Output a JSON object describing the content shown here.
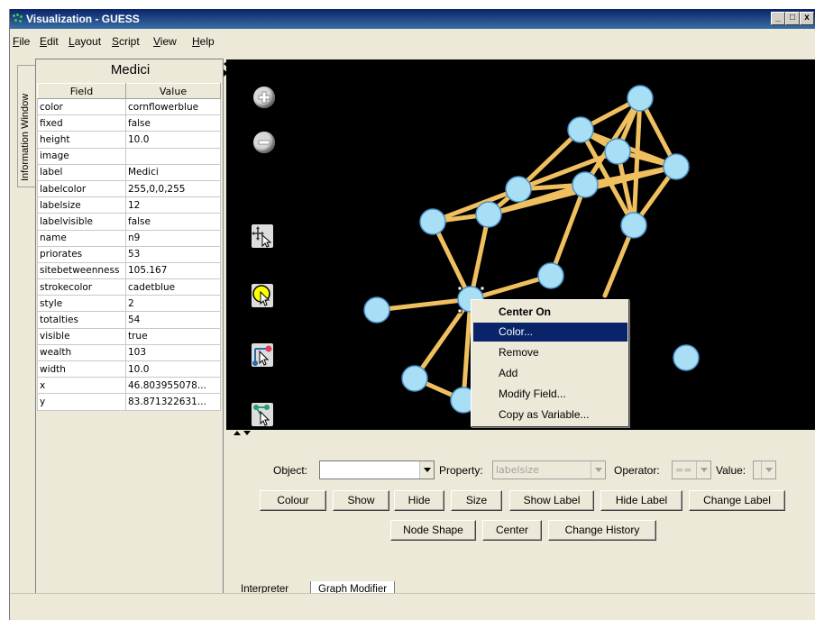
{
  "window": {
    "title": "Visualization - GUESS",
    "buttons": [
      "_",
      "□",
      "x"
    ]
  },
  "menu": [
    {
      "label": "File",
      "underline": "F",
      "rest": "ile"
    },
    {
      "label": "Edit",
      "underline": "E",
      "rest": "dit"
    },
    {
      "label": "Layout",
      "underline": "L",
      "rest": "ayout"
    },
    {
      "label": "Script",
      "underline": "S",
      "rest": "cript"
    },
    {
      "label": "View",
      "underline": "V",
      "rest": "iew"
    },
    {
      "label": "Help",
      "underline": "H",
      "rest": "elp"
    }
  ],
  "side_tab": "Information Window",
  "info": {
    "title": "Medici",
    "columns": [
      "Field",
      "Value"
    ],
    "rows": [
      [
        "color",
        "cornflowerblue"
      ],
      [
        "fixed",
        "false"
      ],
      [
        "height",
        "10.0"
      ],
      [
        "image",
        ""
      ],
      [
        "label",
        "Medici"
      ],
      [
        "labelcolor",
        "255,0,0,255"
      ],
      [
        "labelsize",
        "12"
      ],
      [
        "labelvisible",
        "false"
      ],
      [
        "name",
        "n9"
      ],
      [
        "priorates",
        "53"
      ],
      [
        "sitebetweenness",
        "105.167"
      ],
      [
        "strokecolor",
        "cadetblue"
      ],
      [
        "style",
        "2"
      ],
      [
        "totalties",
        "54"
      ],
      [
        "visible",
        "true"
      ],
      [
        "wealth",
        "103"
      ],
      [
        "width",
        "10.0"
      ],
      [
        "x",
        "46.803955078..."
      ],
      [
        "y",
        "83.871322631..."
      ]
    ]
  },
  "colors": {
    "node_fill": "#a8dff5",
    "node_stroke": "#4a90c8",
    "edge": "#f0c060",
    "canvas": "#000000",
    "menu_highlight": "#0a246a"
  },
  "graph_icons": [
    "zoom-in-icon",
    "zoom-out-icon",
    "move-tool-icon",
    "select-tool-icon",
    "edge-tool-icon",
    "node-drag-tool-icon"
  ],
  "context_menu": {
    "items": [
      {
        "label": "Center On",
        "bold": true,
        "selected": false
      },
      {
        "label": "Color...",
        "bold": false,
        "selected": true
      },
      {
        "label": "Remove",
        "bold": false,
        "selected": false
      },
      {
        "label": "Add",
        "bold": false,
        "selected": false
      },
      {
        "label": "Modify Field...",
        "bold": false,
        "selected": false
      },
      {
        "label": "Copy as Variable...",
        "bold": false,
        "selected": false
      }
    ]
  },
  "modifier": {
    "object_label": "Object:",
    "object_value": "",
    "property_label": "Property:",
    "property_value": "labelsize",
    "operator_label": "Operator:",
    "operator_value": "==",
    "value_label": "Value:",
    "value_value": "",
    "row1": [
      "Colour",
      "Show",
      "Hide",
      "Size",
      "Show Label",
      "Hide Label",
      "Change Label"
    ],
    "row2": [
      "Node Shape",
      "Center",
      "Change History"
    ]
  },
  "tabs": [
    {
      "label": "Interpreter",
      "active": false
    },
    {
      "label": "Graph Modifier",
      "active": true
    }
  ]
}
